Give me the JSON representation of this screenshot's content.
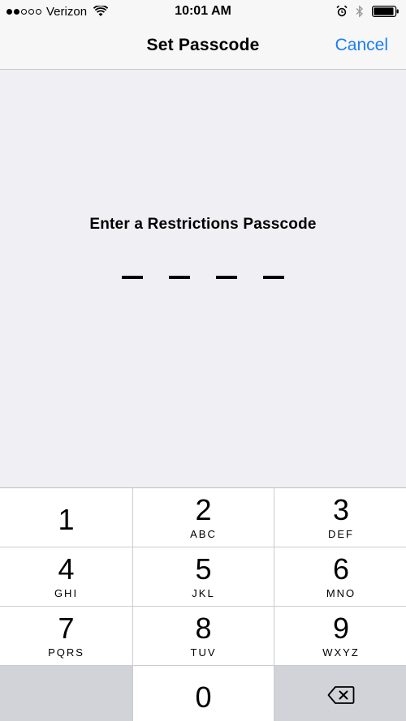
{
  "status_bar": {
    "carrier": "Verizon",
    "signal_filled": 2,
    "signal_total": 5,
    "time": "10:01 AM",
    "battery_level": 0.95
  },
  "nav": {
    "title": "Set Passcode",
    "cancel_label": "Cancel"
  },
  "colors": {
    "accent": "#1a7ef0",
    "background": "#efeff4",
    "bar": "#f7f7f7"
  },
  "passcode": {
    "prompt": "Enter a Restrictions Passcode",
    "digits_entered": 0,
    "length": 4
  },
  "keypad": {
    "keys": [
      {
        "digit": "1",
        "letters": ""
      },
      {
        "digit": "2",
        "letters": "ABC"
      },
      {
        "digit": "3",
        "letters": "DEF"
      },
      {
        "digit": "4",
        "letters": "GHI"
      },
      {
        "digit": "5",
        "letters": "JKL"
      },
      {
        "digit": "6",
        "letters": "MNO"
      },
      {
        "digit": "7",
        "letters": "PQRS"
      },
      {
        "digit": "8",
        "letters": "TUV"
      },
      {
        "digit": "9",
        "letters": "WXYZ"
      },
      {
        "digit": "0",
        "letters": ""
      }
    ],
    "delete_icon": "backspace-icon"
  }
}
